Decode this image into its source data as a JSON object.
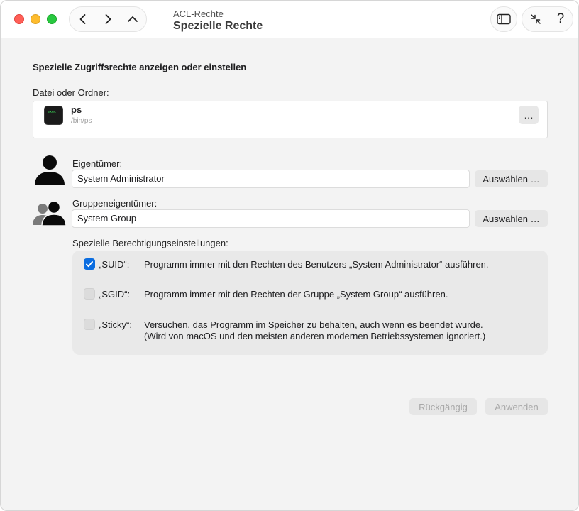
{
  "window": {
    "title_sub": "ACL-Rechte",
    "title_main": "Spezielle Rechte"
  },
  "toolbar": {
    "back_icon": "chevron-left-icon",
    "forward_icon": "chevron-right-icon",
    "up_icon": "chevron-up-icon",
    "sidebar_icon": "sidebar-icon",
    "collapse_icon": "collapse-arrows-icon",
    "help_label": "?"
  },
  "main": {
    "heading": "Spezielle Zugriffsrechte anzeigen oder einstellen",
    "file_label": "Datei oder Ordner:",
    "file": {
      "icon_text": "exec",
      "name": "ps",
      "path": "/bin/ps",
      "more_label": "…"
    },
    "owner": {
      "label": "Eigentümer:",
      "value": "System Administrator",
      "button": "Auswählen …"
    },
    "group": {
      "label": "Gruppeneigentümer:",
      "value": "System Group",
      "button": "Auswählen …"
    },
    "special_label": "Spezielle Berechtigungseinstellungen:",
    "permissions": [
      {
        "tag": "„SUID“:",
        "checked": true,
        "desc1": "Programm immer mit den Rechten des Benutzers „System Administrator“ ausführen.",
        "desc2": ""
      },
      {
        "tag": "„SGID“:",
        "checked": false,
        "desc1": "Programm immer mit den Rechten der Gruppe „System Group“ ausführen.",
        "desc2": ""
      },
      {
        "tag": "„Sticky“:",
        "checked": false,
        "desc1": "Versuchen, das Programm im Speicher zu behalten, auch wenn es beendet wurde.",
        "desc2": "(Wird von macOS und den meisten anderen modernen Betriebssystemen ignoriert.)"
      }
    ]
  },
  "footer": {
    "revert": "Rückgängig",
    "apply": "Anwenden"
  },
  "colors": {
    "accent": "#0b6de0",
    "close": "#ff5f57",
    "minimize": "#febc2e",
    "zoom": "#28c840"
  }
}
